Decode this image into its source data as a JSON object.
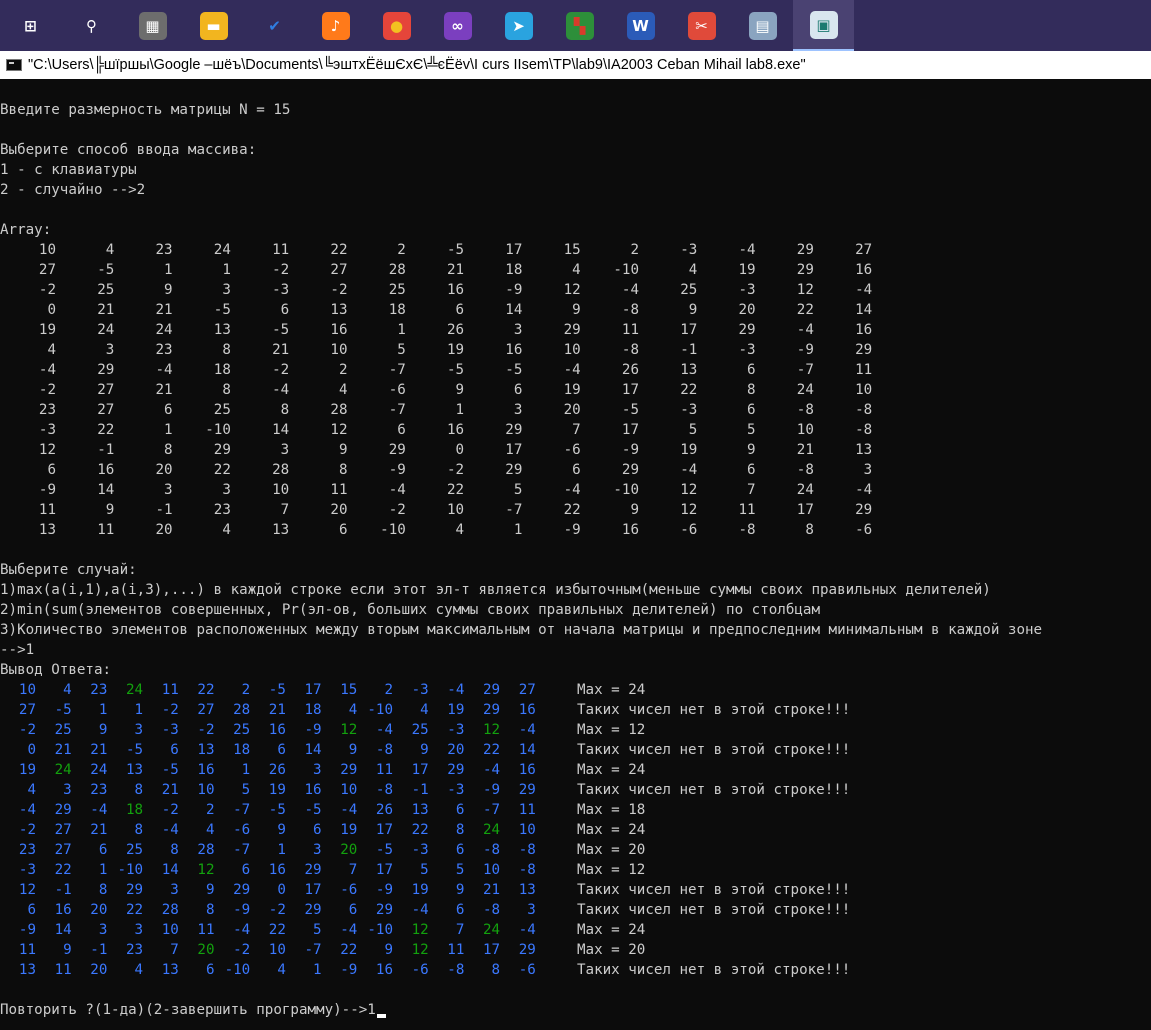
{
  "taskbar": {
    "icons": [
      {
        "name": "windows-start-icon",
        "glyph": "⊞",
        "bg": "transparent",
        "color": "#ffffff"
      },
      {
        "name": "search-icon",
        "glyph": "⚲",
        "bg": "transparent",
        "color": "#ffffff"
      },
      {
        "name": "calculator-icon",
        "glyph": "▦",
        "bg": "#6d6d6d",
        "color": "#ffffff"
      },
      {
        "name": "file-explorer-icon",
        "glyph": "▬",
        "bg": "#f2b51f",
        "color": "#ffffff"
      },
      {
        "name": "todo-icon",
        "glyph": "✔",
        "bg": "transparent",
        "color": "#2f7de1"
      },
      {
        "name": "music-icon",
        "glyph": "♪",
        "bg": "#ff7a1a",
        "color": "#ffffff"
      },
      {
        "name": "chrome-icon",
        "glyph": "●",
        "bg": "#e5453a",
        "color": "#f3c120"
      },
      {
        "name": "visual-studio-icon",
        "glyph": "∞",
        "bg": "#7b3fbf",
        "color": "#ffffff"
      },
      {
        "name": "telegram-icon",
        "glyph": "➤",
        "bg": "#2aa3df",
        "color": "#ffffff"
      },
      {
        "name": "grid-app-icon",
        "glyph": "▚",
        "bg": "#2d8f3a",
        "color": "#d93b2b"
      },
      {
        "name": "word-icon",
        "glyph": "W",
        "bg": "#2b5bb8",
        "color": "#ffffff"
      },
      {
        "name": "snipping-tool-icon",
        "glyph": "✂",
        "bg": "#e04a3a",
        "color": "#ffffff"
      },
      {
        "name": "control-panel-icon",
        "glyph": "▤",
        "bg": "#8aa4c0",
        "color": "#ffffff"
      },
      {
        "name": "console-app-icon",
        "glyph": "▣",
        "bg": "#d9e6ef",
        "color": "#1b7a70"
      }
    ]
  },
  "window": {
    "title": "\"C:\\Users\\╠шїршы\\Google –шёъ\\Documents\\╚эштхЁёшЄхЄ\\╩єЁёv\\I curs IIsem\\TP\\lab9\\IA2003 Ceban Mihail lab8.exe\""
  },
  "console": {
    "prompt_size": "Введите размерность матрицы N = 15",
    "prompt_method": "Выберите способ ввода массива:",
    "option_keyboard": "1 - с клавиатуры",
    "option_random": "2 - случайно -->2",
    "array_label": "Array:",
    "matrix": [
      [
        10,
        4,
        23,
        24,
        11,
        22,
        2,
        -5,
        17,
        15,
        2,
        -3,
        -4,
        29,
        27
      ],
      [
        27,
        -5,
        1,
        1,
        -2,
        27,
        28,
        21,
        18,
        4,
        -10,
        4,
        19,
        29,
        16
      ],
      [
        -2,
        25,
        9,
        3,
        -3,
        -2,
        25,
        16,
        -9,
        12,
        -4,
        25,
        -3,
        12,
        -4
      ],
      [
        0,
        21,
        21,
        -5,
        6,
        13,
        18,
        6,
        14,
        9,
        -8,
        9,
        20,
        22,
        14
      ],
      [
        19,
        24,
        24,
        13,
        -5,
        16,
        1,
        26,
        3,
        29,
        11,
        17,
        29,
        -4,
        16
      ],
      [
        4,
        3,
        23,
        8,
        21,
        10,
        5,
        19,
        16,
        10,
        -8,
        -1,
        -3,
        -9,
        29
      ],
      [
        -4,
        29,
        -4,
        18,
        -2,
        2,
        -7,
        -5,
        -5,
        -4,
        26,
        13,
        6,
        -7,
        11
      ],
      [
        -2,
        27,
        21,
        8,
        -4,
        4,
        -6,
        9,
        6,
        19,
        17,
        22,
        8,
        24,
        10
      ],
      [
        23,
        27,
        6,
        25,
        8,
        28,
        -7,
        1,
        3,
        20,
        -5,
        -3,
        6,
        -8,
        -8
      ],
      [
        -3,
        22,
        1,
        -10,
        14,
        12,
        6,
        16,
        29,
        7,
        17,
        5,
        5,
        10,
        -8
      ],
      [
        12,
        -1,
        8,
        29,
        3,
        9,
        29,
        0,
        17,
        -6,
        -9,
        19,
        9,
        21,
        13
      ],
      [
        6,
        16,
        20,
        22,
        28,
        8,
        -9,
        -2,
        29,
        6,
        29,
        -4,
        6,
        -8,
        3
      ],
      [
        -9,
        14,
        3,
        3,
        10,
        11,
        -4,
        22,
        5,
        -4,
        -10,
        12,
        7,
        24,
        -4
      ],
      [
        11,
        9,
        -1,
        23,
        7,
        20,
        -2,
        10,
        -7,
        22,
        9,
        12,
        11,
        17,
        29
      ],
      [
        13,
        11,
        20,
        4,
        13,
        6,
        -10,
        4,
        1,
        -9,
        16,
        -6,
        -8,
        8,
        -6
      ]
    ],
    "choose_case": "Выберите случай:",
    "case1": "1)max(a(i,1),a(i,3),...) в каждой строке если этот эл-т является избыточным(меньше суммы своих правильных делителей)",
    "case2": "2)min(sum(элементов совершенных, Pr(эл-ов, больших суммы своих правильных делителей) по столбцам",
    "case3": "3)Количество элементов расположенных между вторым максимальным от начала матрицы и предпоследним минимальным в каждой зоне",
    "case_input": "-->1",
    "answer_label": "Вывод Ответа:",
    "highlights": [
      [
        3
      ],
      [],
      [
        9,
        13
      ],
      [],
      [
        1
      ],
      [],
      [
        3
      ],
      [
        13
      ],
      [
        9
      ],
      [
        5
      ],
      [],
      [],
      [
        11,
        13
      ],
      [
        5,
        11
      ],
      []
    ],
    "results": [
      "Max = 24",
      "Таких чисел нет в этой строке!!!",
      "Max = 12",
      "Таких чисел нет в этой строке!!!",
      "Max = 24",
      "Таких чисел нет в этой строке!!!",
      "Max = 18",
      "Max = 24",
      "Max = 20",
      "Max = 12",
      "Таких чисел нет в этой строке!!!",
      "Таких чисел нет в этой строке!!!",
      "Max = 24",
      "Max = 20",
      "Таких чисел нет в этой строке!!!"
    ],
    "repeat_prompt": "Повторить ?(1-да)(2-завершить программу)-->1"
  },
  "colors": {
    "console_bg": "#0c0c0c",
    "text": "#cccccc",
    "answer_blue": "#3b78ff",
    "answer_green": "#13a10e"
  }
}
